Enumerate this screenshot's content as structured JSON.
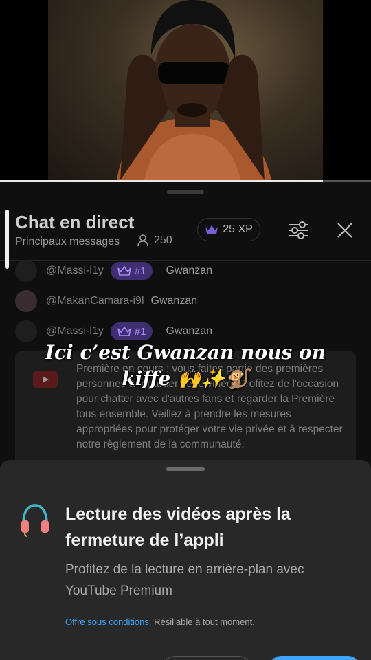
{
  "video": {
    "progress_fraction": 0.87
  },
  "chat": {
    "title": "Chat en direct",
    "mode": "Principaux messages",
    "viewer_count": "250",
    "xp": "25 XP",
    "messages": [
      {
        "author": "@Massi-l1y",
        "rank": "#1",
        "text": "Gwanzan"
      },
      {
        "author": "@MakanCamara-i9l",
        "text": "Gwanzan"
      },
      {
        "author": "@Massi-l1y",
        "rank": "#1",
        "text": "Gwanzan"
      }
    ],
    "notice": "Première en cours : vous faites partie des premières personnes à regarder cette vidéo. Profitez de l'occasion pour chatter avec d'autres fans et regarder la Première tous ensemble. Veillez à prendre les mesures appropriées pour protéger votre vie privée et à respecter notre règlement de la communauté."
  },
  "caption": {
    "line1": "Ici c’est Gwanzan nous on",
    "line2": "kiffe 🙌✨🐒"
  },
  "sheet": {
    "title": "Lecture des vidéos après la fermeture de l’appli",
    "subtitle": "Profitez de la lecture en arrière-plan avec YouTube Premium",
    "terms_link": "Offre sous conditions.",
    "terms_rest": " Résiliable à tout moment."
  },
  "colors": {
    "accent_blue": "#3ea6ff",
    "rank_badge": "#3f2f72",
    "youtube_red": "#ff0000"
  }
}
